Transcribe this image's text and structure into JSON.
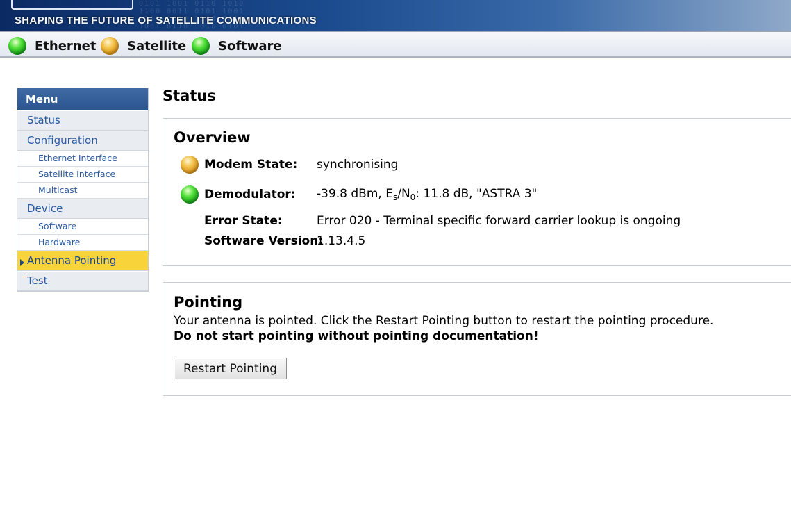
{
  "banner": {
    "slogan": "SHAPING THE FUTURE OF SATELLITE COMMUNICATIONS"
  },
  "statusbar": {
    "items": [
      {
        "label": "Ethernet",
        "status": "green"
      },
      {
        "label": "Satellite",
        "status": "yellow"
      },
      {
        "label": "Software",
        "status": "green"
      }
    ]
  },
  "menu": {
    "header": "Menu",
    "items": [
      {
        "label": "Status"
      },
      {
        "label": "Configuration"
      },
      {
        "label": "Ethernet Interface"
      },
      {
        "label": "Satellite Interface"
      },
      {
        "label": "Multicast"
      },
      {
        "label": "Device"
      },
      {
        "label": "Software"
      },
      {
        "label": "Hardware"
      },
      {
        "label": "Antenna Pointing"
      },
      {
        "label": "Test"
      }
    ]
  },
  "page": {
    "title": "Status"
  },
  "overview": {
    "heading": "Overview",
    "modem_state_label": "Modem State:",
    "modem_state_value": "synchronising",
    "modem_state_status": "yellow",
    "demodulator_label": "Demodulator:",
    "demodulator_value_prefix": "-39.8 dBm, E",
    "demodulator_sub1": "s",
    "demodulator_mid": "/N",
    "demodulator_sub2": "0",
    "demodulator_value_suffix": ": 11.8 dB, \"ASTRA 3\"",
    "demodulator_status": "green",
    "error_state_label": "Error State:",
    "error_state_value": "Error 020 - Terminal specific forward carrier lookup is ongoing",
    "software_version_label": "Software Version:",
    "software_version_value": "1.13.4.5"
  },
  "pointing": {
    "heading": "Pointing",
    "text": "Your antenna is pointed. Click the Restart Pointing button to restart the pointing procedure.",
    "warning": "Do not start pointing without pointing documentation!",
    "button_label": "Restart Pointing"
  },
  "colors": {
    "accent": "#2a5490",
    "active_menu": "#f9d33a",
    "link": "#2a5aa0"
  }
}
